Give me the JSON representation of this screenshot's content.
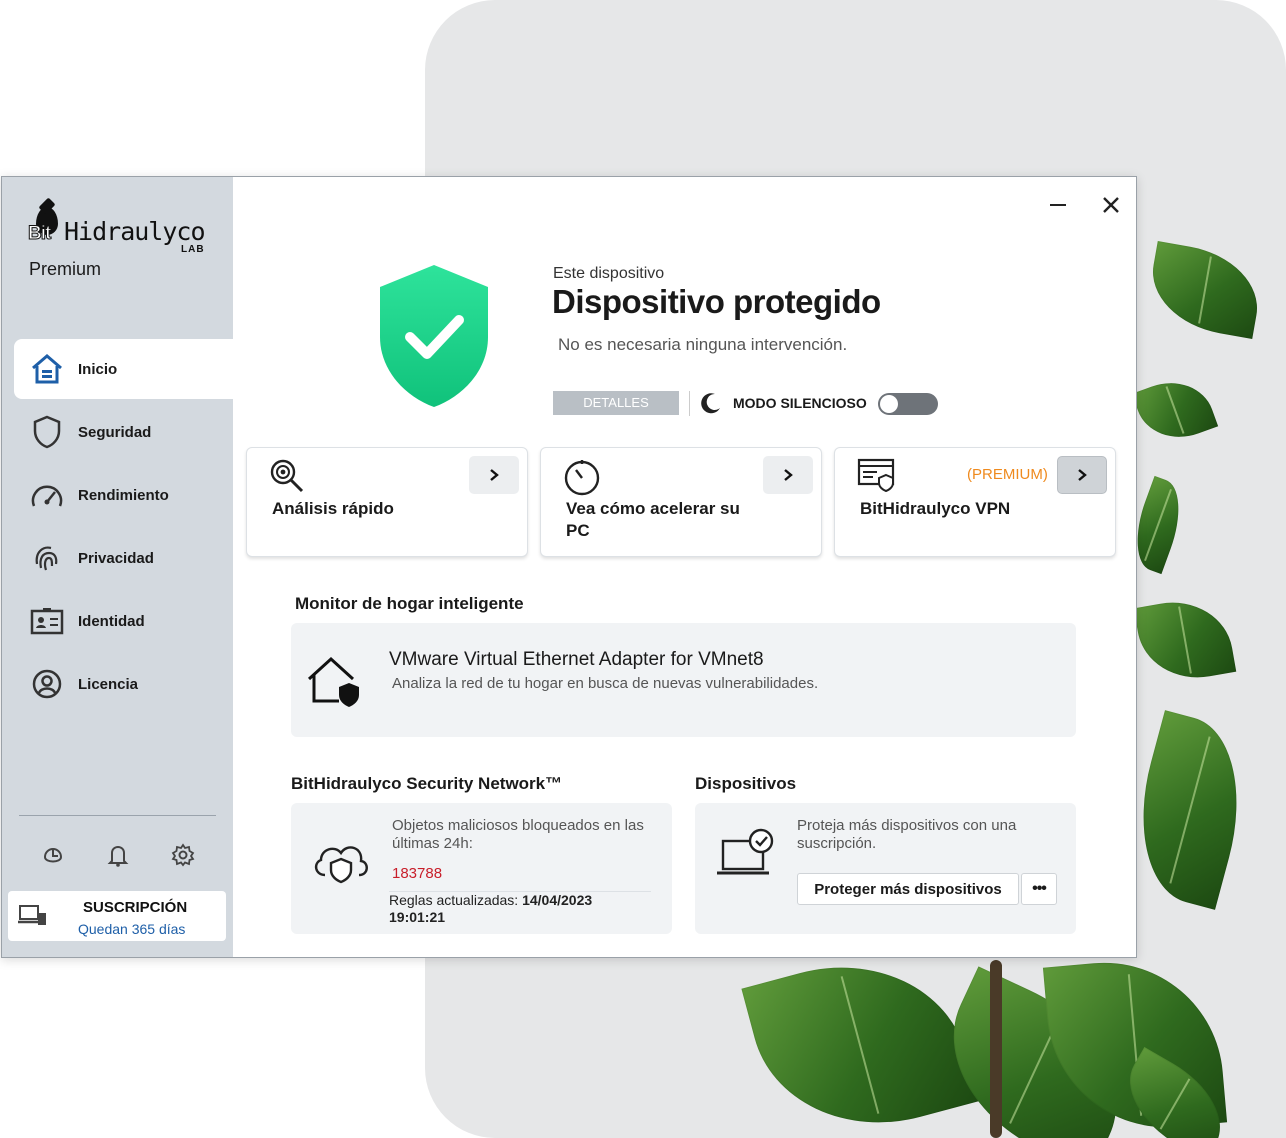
{
  "brand": {
    "logo_text": "BitHidraulyco LAB",
    "tier": "Premium",
    "colors": {
      "accent_blue": "#1e5fa8",
      "shield_green": "#12c880",
      "premium_orange": "#ef8a1e",
      "alert_red": "#c81e2a",
      "sidebar_bg": "#d3d9df"
    }
  },
  "sidebar": {
    "items": [
      {
        "label": "Inicio",
        "icon": "home-icon",
        "active": true
      },
      {
        "label": "Seguridad",
        "icon": "shield-outline-icon",
        "active": false
      },
      {
        "label": "Rendimiento",
        "icon": "speedometer-icon",
        "active": false
      },
      {
        "label": "Privacidad",
        "icon": "fingerprint-icon",
        "active": false
      },
      {
        "label": "Identidad",
        "icon": "id-card-icon",
        "active": false
      },
      {
        "label": "Licencia",
        "icon": "user-circle-icon",
        "active": false
      }
    ],
    "tools": [
      "support-icon",
      "bell-icon",
      "gear-icon"
    ],
    "subscription": {
      "title": "SUSCRIPCIÓN",
      "days": "Quedan 365 días"
    }
  },
  "status": {
    "device_label": "Este dispositivo",
    "title": "Dispositivo protegido",
    "subtitle": "No es necesaria ninguna intervención.",
    "details_label": "DETALLES",
    "silent_label": "MODO SILENCIOSO",
    "silent_on": false
  },
  "quick_cards": [
    {
      "title": "Análisis rápido",
      "icon": "magnifier-scan-icon"
    },
    {
      "title": "Vea cómo acelerar su PC",
      "icon": "stopwatch-icon"
    },
    {
      "title": "BitHidraulyco VPN",
      "icon": "vpn-window-shield-icon",
      "tag": "(PREMIUM)"
    }
  ],
  "home_monitor": {
    "section_title": "Monitor de hogar inteligente",
    "adapter": "VMware Virtual Ethernet Adapter for VMnet8",
    "description": "Analiza la red de tu hogar en busca de nuevas vulnerabilidades."
  },
  "security_network": {
    "section_title": "BitHidraulyco Security Network™",
    "blocked_label": "Objetos maliciosos bloqueados en las últimas 24h:",
    "blocked_count": "183788",
    "rules_label": "Reglas actualizadas:",
    "rules_date": "14/04/2023",
    "rules_time": "19:01:21"
  },
  "devices": {
    "section_title": "Dispositivos",
    "text": "Proteja más dispositivos con una suscripción.",
    "button": "Proteger más dispositivos",
    "more": "•••"
  }
}
